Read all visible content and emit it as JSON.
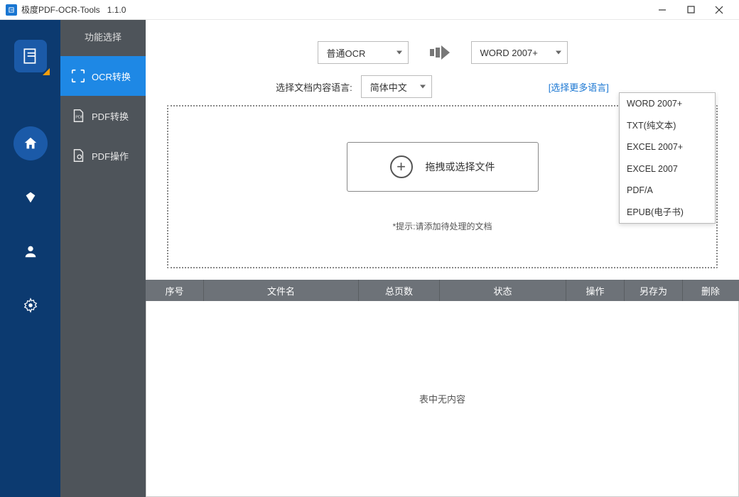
{
  "titlebar": {
    "app_name": "极度PDF-OCR-Tools",
    "version": "1.1.0"
  },
  "rail": {
    "items": [
      "home",
      "diamond",
      "user",
      "gear"
    ]
  },
  "sidebar": {
    "title": "功能选择",
    "items": [
      {
        "label": "OCR转换",
        "icon_text": "OCR"
      },
      {
        "label": "PDF转换",
        "icon_text": "PDF"
      },
      {
        "label": "PDF操作",
        "icon_text": "PDF"
      }
    ]
  },
  "config": {
    "ocr_mode": "普通OCR",
    "output_format": "WORD 2007+",
    "lang_label": "选择文档内容语言:",
    "lang_value": "简体中文",
    "more_lang": "[选择更多语言]",
    "format_options": [
      "WORD 2007+",
      "TXT(纯文本)",
      "EXCEL 2007+",
      "EXCEL 2007",
      "PDF/A",
      "EPUB(电子书)"
    ]
  },
  "dropzone": {
    "choose_label": "拖拽或选择文件",
    "hint": "*提示:请添加待处理的文档"
  },
  "table": {
    "headers": {
      "seq": "序号",
      "name": "文件名",
      "pages": "总页数",
      "status": "状态",
      "op": "操作",
      "saveas": "另存为",
      "del": "删除"
    },
    "empty": "表中无内容"
  }
}
